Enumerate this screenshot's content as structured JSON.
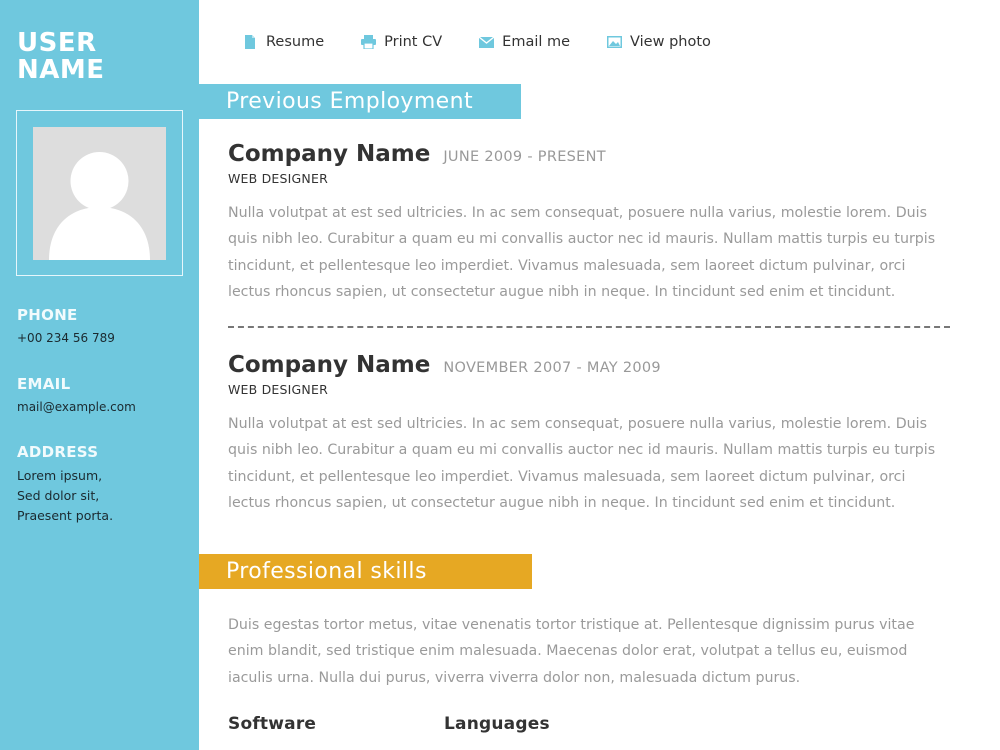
{
  "sidebar": {
    "user_name_line1": "USER",
    "user_name_line2": "NAME",
    "phone_label": "PHONE",
    "phone_value": "+00 234 56 789",
    "email_label": "EMAIL",
    "email_value": "mail@example.com",
    "address_label": "ADDRESS",
    "address_lines": [
      "Lorem ipsum,",
      "Sed dolor sit,",
      "Praesent porta."
    ]
  },
  "nav": {
    "items": [
      {
        "label": "Resume",
        "icon": "document-icon"
      },
      {
        "label": "Print CV",
        "icon": "printer-icon"
      },
      {
        "label": "Email me",
        "icon": "envelope-icon"
      },
      {
        "label": "View photo",
        "icon": "image-icon"
      }
    ]
  },
  "employment": {
    "title": "Previous Employment",
    "jobs": [
      {
        "company": "Company Name",
        "dates": "JUNE 2009 - PRESENT",
        "role": "WEB DESIGNER",
        "description": "Nulla volutpat at est sed ultricies. In ac sem consequat, posuere nulla varius, molestie lorem. Duis quis nibh leo. Curabitur a quam eu mi convallis auctor nec id mauris. Nullam mattis turpis eu turpis tincidunt, et pellentesque leo imperdiet. Vivamus malesuada, sem laoreet dictum pulvinar, orci lectus rhoncus sapien, ut consectetur augue nibh in neque. In tincidunt sed enim et tincidunt."
      },
      {
        "company": "Company Name",
        "dates": "NOVEMBER 2007 - MAY 2009",
        "role": "WEB DESIGNER",
        "description": "Nulla volutpat at est sed ultricies. In ac sem consequat, posuere nulla varius, molestie lorem. Duis quis nibh leo. Curabitur a quam eu mi convallis auctor nec id mauris. Nullam mattis turpis eu turpis tincidunt, et pellentesque leo imperdiet. Vivamus malesuada, sem laoreet dictum pulvinar, orci lectus rhoncus sapien, ut consectetur augue nibh in neque. In tincidunt sed enim et tincidunt."
      }
    ]
  },
  "skills": {
    "title": "Professional skills",
    "description": "Duis egestas tortor metus, vitae venenatis tortor tristique at. Pellentesque dignissim purus vitae enim blandit, sed tristique enim malesuada. Maecenas dolor erat, volutpat a tellus eu, euismod iaculis urna. Nulla dui purus, viverra viverra dolor non, malesuada dictum purus.",
    "software_label": "Software",
    "languages_label": "Languages"
  },
  "colors": {
    "sidebar_blue": "#6fc8de",
    "skills_orange": "#e6a823",
    "body_text_gray": "#9a9a9a"
  }
}
